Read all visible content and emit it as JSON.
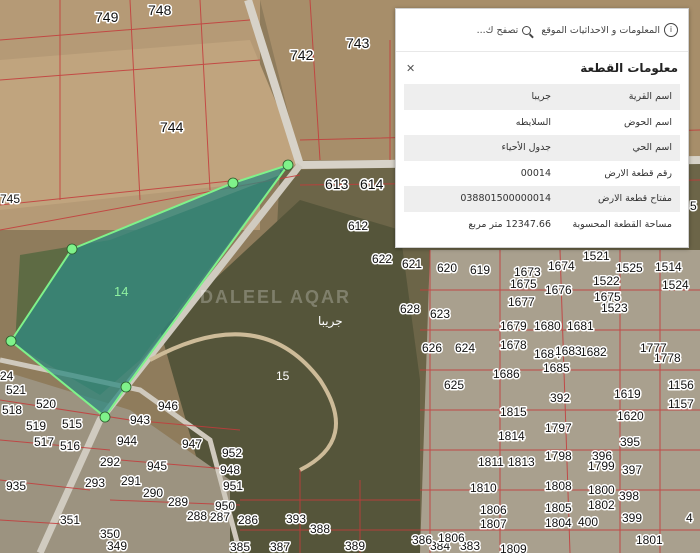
{
  "map": {
    "selected_parcel_label": "14",
    "village_label": "جريبا",
    "road_label": "15",
    "watermark": "DALEEL AQAR",
    "parcel_numbers": [
      "749",
      "748",
      "743",
      "742",
      "744",
      "745",
      "613",
      "614",
      "612",
      "622",
      "621",
      "620",
      "619",
      "1673",
      "1674",
      "1521",
      "1525",
      "1514",
      "1675",
      "1676",
      "1522",
      "1524",
      "1677",
      "1675",
      "1523",
      "628",
      "623",
      "1680",
      "1681",
      "1679",
      "1678",
      "626",
      "624",
      "1684",
      "1682",
      "1777",
      "1683",
      "1685",
      "1686",
      "1778",
      "625",
      "1619",
      "1156",
      "1815",
      "392",
      "1620",
      "1157",
      "1814",
      "1797",
      "395",
      "1811",
      "1813",
      "1798",
      "396",
      "397",
      "1810",
      "1808",
      "1799",
      "398",
      "1806",
      "1805",
      "1800",
      "399",
      "1807",
      "1804",
      "1802",
      "400",
      "1801",
      "4",
      "520",
      "519",
      "515",
      "518",
      "516",
      "517",
      "935",
      "943",
      "944",
      "946",
      "945",
      "947",
      "292",
      "948",
      "293",
      "291",
      "951",
      "290",
      "289",
      "950",
      "288",
      "287",
      "286",
      "351",
      "350",
      "349",
      "393",
      "388",
      "389",
      "387",
      "385",
      "384",
      "383",
      "386",
      "24",
      "521",
      "952",
      "5",
      "1806",
      "1809"
    ]
  },
  "panel": {
    "tab_search": "تصفح ك...",
    "tab_info": "المعلومات و الاحداثيات الموقع",
    "title": "معلومات القطعة",
    "close_label": "✕",
    "rows": [
      {
        "key": "اسم القرية",
        "value": "جريبا"
      },
      {
        "key": "اسم الحوض",
        "value": "السلايطه"
      },
      {
        "key": "اسم الحي",
        "value": "جدول الأحياء"
      },
      {
        "key": "رقم قطعة الارض",
        "value": "00014"
      },
      {
        "key": "مفتاح قطعة الارض",
        "value": "038801500000014"
      },
      {
        "key": "مساحة القطعة المحسوبة",
        "value": "12347.66 متر مربع"
      }
    ]
  },
  "watermark_brand": {
    "ar": "السوق المفتوح",
    "en": "opensooq"
  },
  "colors": {
    "selected_fill": "#2f8a82",
    "selected_stroke": "#7ff28a",
    "parcel_line": "#c43b3b"
  }
}
